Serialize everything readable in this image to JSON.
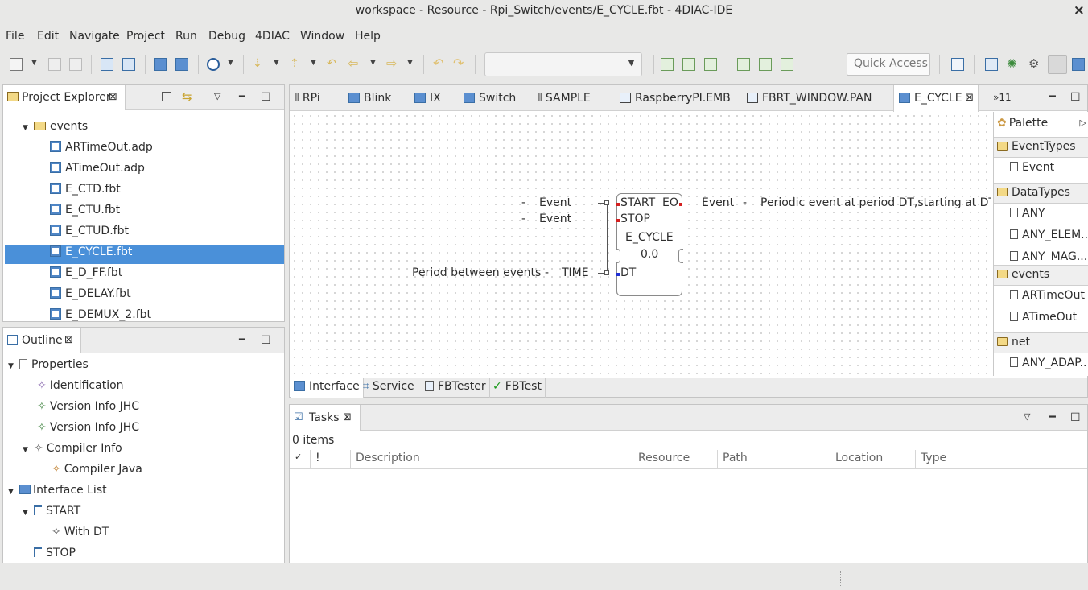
{
  "window": {
    "title": "workspace - Resource - Rpi_Switch/events/E_CYCLE.fbt - 4DIAC-IDE",
    "close": "×"
  },
  "menu": [
    "File",
    "Edit",
    "Navigate",
    "Project",
    "Run",
    "Debug",
    "4DIAC",
    "Window",
    "Help"
  ],
  "toolbar": {
    "quick_access_placeholder": "Quick Access",
    "combo_value": ""
  },
  "project_explorer": {
    "title": "Project Explorer",
    "folder": "events",
    "files": [
      "ARTimeOut.adp",
      "ATimeOut.adp",
      "E_CTD.fbt",
      "E_CTU.fbt",
      "E_CTUD.fbt",
      "E_CYCLE.fbt",
      "E_D_FF.fbt",
      "E_DELAY.fbt",
      "E_DEMUX_2.fbt"
    ],
    "selected": "E_CYCLE.fbt"
  },
  "outline": {
    "title": "Outline",
    "items": [
      "Properties",
      "Identification",
      "Version Info JHC",
      "Version Info JHC",
      "Compiler Info",
      "Compiler Java",
      "Interface List",
      "START",
      "With DT",
      "STOP"
    ]
  },
  "editor": {
    "tabs": [
      "RPi",
      "Blink",
      "IX",
      "Switch",
      "SAMPLE",
      "RaspberryPI.EMB",
      "FBRT_WINDOW.PAN",
      "E_CYCLE"
    ],
    "overflow": "»11",
    "bottom_tabs": [
      "Interface",
      "Service",
      "FBTester",
      "FBTest"
    ],
    "fb": {
      "name": "E_CYCLE",
      "version": "0.0",
      "inputs": [
        {
          "dash": "-",
          "type": "Event",
          "name": "START"
        },
        {
          "dash": "-",
          "type": "Event",
          "name": "STOP"
        }
      ],
      "outputs": [
        {
          "name": "EO",
          "type": "Event",
          "dash": "-",
          "comment": "Periodic event at period DT,starting at DT afte"
        }
      ],
      "data_inputs": [
        {
          "comment": "Period between events",
          "dash": "-",
          "type": "TIME",
          "name": "DT"
        }
      ]
    }
  },
  "palette": {
    "title": "Palette",
    "groups": [
      {
        "name": "EventTypes",
        "items": [
          "Event"
        ]
      },
      {
        "name": "DataTypes",
        "items": [
          "ANY",
          "ANY_ELEM...",
          "ANY_MAG..."
        ]
      },
      {
        "name": "events",
        "items": [
          "ARTimeOut",
          "ATimeOut"
        ]
      },
      {
        "name": "net",
        "items": [
          "ANY_ADAP..."
        ]
      }
    ]
  },
  "tasks": {
    "title": "Tasks",
    "count": "0 items",
    "columns": [
      "✓",
      "!",
      "Description",
      "Resource",
      "Path",
      "Location",
      "Type"
    ]
  }
}
